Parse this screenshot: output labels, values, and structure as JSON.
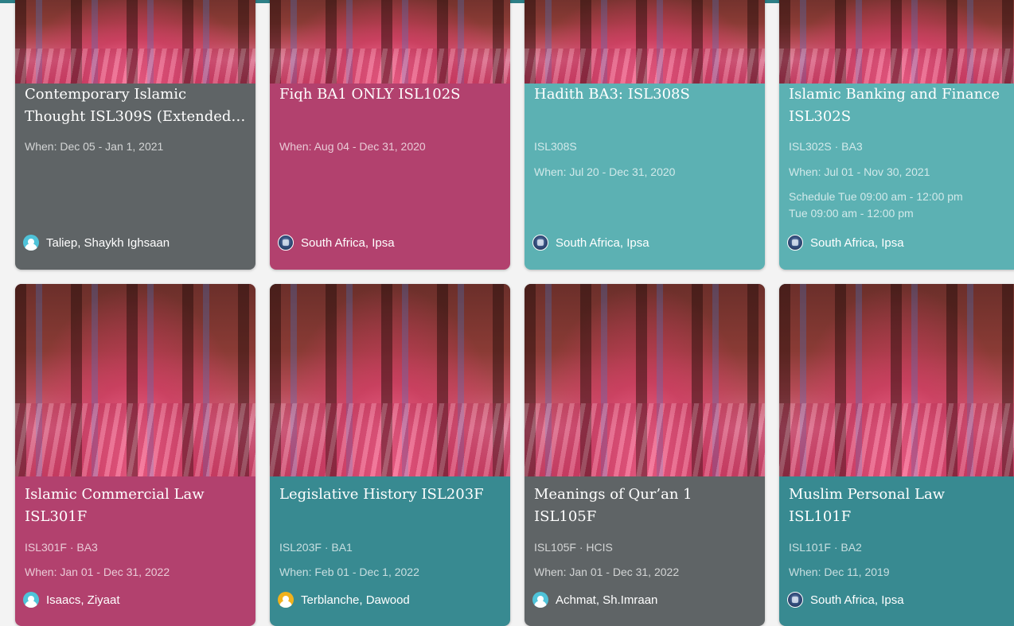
{
  "colors": {
    "gray": "#5f6466",
    "pink": "#b2416e",
    "light_teal": "#5cb1b3",
    "teal": "#388a91",
    "top_bar": "#2d7f86"
  },
  "courses": [
    {
      "title_line1": "Contemporary Islamic",
      "title_line2": "Thought ISL309S (Extended…",
      "line1": "When: Dec 05 - Jan 1, 2021",
      "instructor": "Taliep, Shaykh Ighsaan",
      "avatar_icon": "person-icon"
    },
    {
      "title_line1": "Fiqh BA1 ONLY ISL102S",
      "line1": "When: Aug 04 - Dec 31, 2020",
      "instructor": "South Africa, Ipsa",
      "avatar_icon": "crest-icon"
    },
    {
      "title_line1": "Hadith BA3: ISL308S",
      "line1": "ISL308S",
      "line2": "When: Jul 20 - Dec 31, 2020",
      "instructor": "South Africa, Ipsa",
      "avatar_icon": "crest-icon"
    },
    {
      "title_line1": "Islamic Banking and Finance",
      "title_line2": "ISL302S",
      "line1": "ISL302S · BA3",
      "line2": "When: Jul 01 - Nov 30, 2021",
      "line3": "Schedule Tue 09:00 am - 12:00 pm",
      "line4": "Tue 09:00 am - 12:00 pm",
      "instructor": "South Africa, Ipsa",
      "avatar_icon": "crest-icon"
    },
    {
      "title_line1": "Islamic Commercial Law",
      "title_line2": "ISL301F",
      "line1": "ISL301F · BA3",
      "line2": "When: Jan 01 - Dec 31, 2022",
      "instructor": "Isaacs, Ziyaat",
      "avatar_icon": "person-icon"
    },
    {
      "title_line1": "Legislative History ISL203F",
      "line1": "ISL203F · BA1",
      "line2": "When: Feb 01 - Dec 1, 2022",
      "instructor": "Terblanche, Dawood",
      "avatar_icon": "person-icon"
    },
    {
      "title_line1": "Meanings of Qur’an 1 ISL105F",
      "line1": "ISL105F · HCIS",
      "line2": "When: Jan 01 - Dec 31, 2022",
      "instructor": "Achmat, Sh.Imraan",
      "avatar_icon": "person-icon"
    },
    {
      "title_line1": "Muslim Personal Law",
      "title_line2": "ISL101F",
      "line1": "ISL101F · BA2",
      "line2": "When: Dec 11, 2019",
      "instructor": "South Africa, Ipsa",
      "avatar_icon": "crest-icon"
    }
  ]
}
